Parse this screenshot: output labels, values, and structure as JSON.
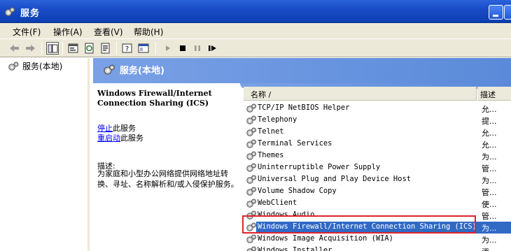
{
  "window": {
    "title": "服务"
  },
  "menu": [
    "文件(F)",
    "操作(A)",
    "查看(V)",
    "帮助(H)"
  ],
  "tree": {
    "root_label": "服务(本地)"
  },
  "banner": {
    "title": "服务(本地)"
  },
  "details": {
    "service_title": "Windows Firewall/Internet Connection Sharing (ICS)",
    "stop_link": "停止",
    "stop_suffix": "此服务",
    "restart_link": "重启动",
    "restart_suffix": "此服务",
    "desc_label": "描述:",
    "desc_text": "为家庭和小型办公网络提供网络地址转换、寻址、名称解析和/或入侵保护服务。"
  },
  "list": {
    "columns": {
      "name": "名称 /",
      "description": "描述"
    },
    "rows": [
      {
        "name": "TCP/IP NetBIOS Helper",
        "desc": "允..."
      },
      {
        "name": "Telephony",
        "desc": "提..."
      },
      {
        "name": "Telnet",
        "desc": "允..."
      },
      {
        "name": "Terminal Services",
        "desc": "允..."
      },
      {
        "name": "Themes",
        "desc": "为..."
      },
      {
        "name": "Uninterruptible Power Supply",
        "desc": "管..."
      },
      {
        "name": "Universal Plug and Play Device Host",
        "desc": "为..."
      },
      {
        "name": "Volume Shadow Copy",
        "desc": "管..."
      },
      {
        "name": "WebClient",
        "desc": "使..."
      },
      {
        "name": "Windows Audio",
        "desc": "管..."
      },
      {
        "name": "Windows Firewall/Internet Connection Sharing (ICS)",
        "desc": "为...",
        "selected": true
      },
      {
        "name": "Windows Image Acquisition (WIA)",
        "desc": "为..."
      },
      {
        "name": "Windows Installer",
        "desc": "添..."
      }
    ]
  },
  "colors": {
    "titlebar": "#0b3fb0",
    "banner": "#6b95df",
    "selection": "#316ac5",
    "highlight_box": "#e0242c"
  },
  "icons": [
    "services-gear-icon",
    "back-arrow-icon",
    "forward-arrow-icon",
    "show-hide-tree-icon",
    "properties-icon",
    "refresh-icon",
    "export-list-icon",
    "help-icon",
    "console-icon",
    "start-service-icon",
    "stop-service-icon",
    "pause-service-icon",
    "restart-service-icon"
  ]
}
